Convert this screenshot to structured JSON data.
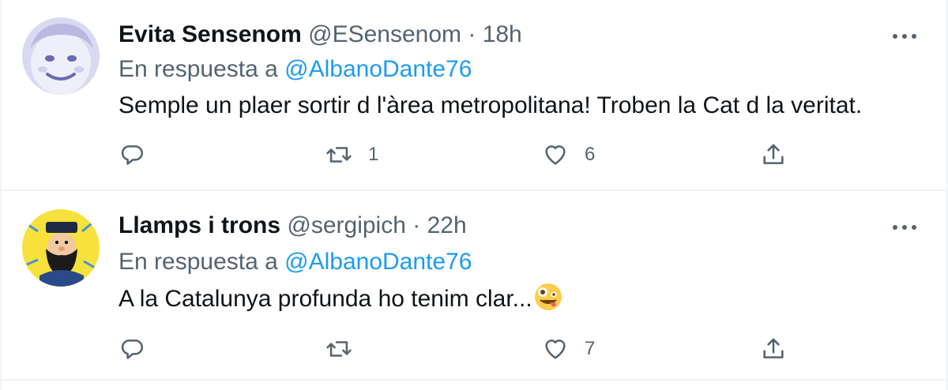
{
  "tweets": [
    {
      "display_name": "Evita Sensenom",
      "handle": "@ESensenom",
      "separator": "·",
      "time": "18h",
      "reply_prefix": "En respuesta a",
      "reply_to": "@AlbanoDante76",
      "text": "Semple un plaer sortir d l'àrea metropolitana! Troben la Cat d la  veritat.",
      "retweets": "1",
      "likes": "6",
      "avatar_icon": "child-face-avatar"
    },
    {
      "display_name": "Llamps i trons",
      "handle": "@sergipich",
      "separator": "·",
      "time": "22h",
      "reply_prefix": "En respuesta a",
      "reply_to": "@AlbanoDante76",
      "text": "A la Catalunya profunda ho tenim clar...",
      "retweets": "",
      "likes": "7",
      "avatar_icon": "bearded-sailor-avatar",
      "emoji": "zany-face-emoji"
    }
  ],
  "colors": {
    "accent": "#1d9bf0",
    "secondary_text": "#536471",
    "primary_text": "#0f1419",
    "divider": "#eff3f4"
  }
}
